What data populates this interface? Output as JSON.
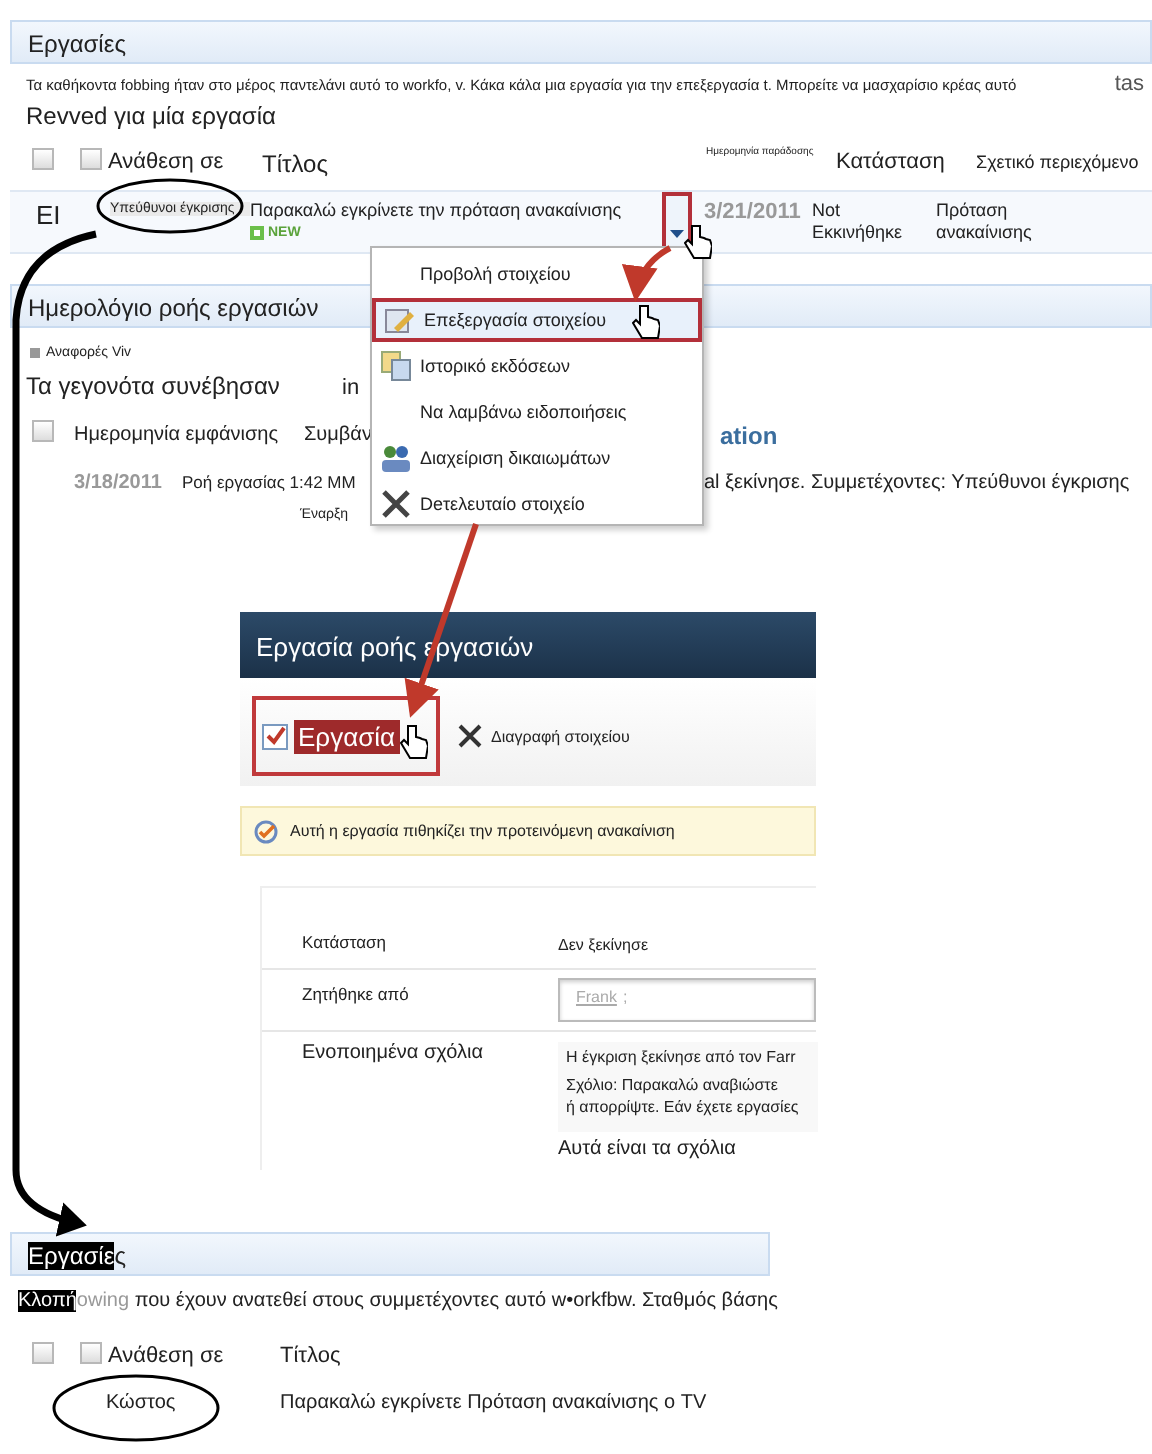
{
  "tasks": {
    "title": "Εργασίες",
    "description": "Τα καθήκοντα fobbing ήταν στο μέρος παντελάνι αυτό το workfo, v. Κάκα κάλα μια εργασία για την επεξεργασία t. Μπορείτε να μασχαρίσιο κρέας αυτό",
    "edge_text": "tas",
    "subtitle": "Revved για μία εργασία",
    "select_all": {
      "checked": false
    },
    "select_assigned": {
      "checked": false
    },
    "columns": [
      "Ανάθεση σε",
      "Τίτλος",
      "Ημερομηνία παράδοσης",
      "Κατάσταση",
      "Σχετικό περιεχόμενο"
    ],
    "rows": [
      {
        "code": "EI",
        "assigned_to": "Υπεύθυνοι έγκρισης",
        "title": "Παρακαλώ εγκρίνετε την πρόταση ανακαίνισης",
        "badge": "NEW",
        "due_date": "3/21/2011",
        "status": "Not Εκκινήθηκε",
        "related": "Πρόταση ανακαίνισης"
      }
    ]
  },
  "workflow_history": {
    "title": "Ημερολόγιο ροής εργασιών",
    "reports": "Αναφορές Viv",
    "subtitle": "Τα γεγονότα συνέβησαν",
    "subtitle_cut": "in",
    "select_all": {
      "checked": false
    },
    "columns": [
      "Ημερομηνία εμφάνισης",
      "Συμβάν",
      "ation"
    ],
    "rows": [
      {
        "date": "3/18/2011",
        "event": "Ροή εργασίας 1:42 MM",
        "description": "al ξεκίνησε. Συμμετέχοντες: Υπεύθυνοι έγκρισης",
        "note": "Έναρξη"
      }
    ]
  },
  "context_menu": {
    "items": [
      {
        "label": "Προβολή στοιχείου",
        "kind": "plain",
        "selected": false
      },
      {
        "label": "Επεξεργασία στοιχείου",
        "kind": "edit",
        "selected": true
      },
      {
        "label": "Ιστορικό εκδόσεων",
        "kind": "versions",
        "selected": false
      },
      {
        "label": "Να λαμβάνω ειδοποιήσεις",
        "kind": "plain",
        "selected": false
      },
      {
        "label": "Διαχείριση δικαιωμάτων",
        "kind": "permissions",
        "selected": false
      },
      {
        "label": "Deτελευταίο στοιχείο",
        "kind": "delete",
        "selected": false
      }
    ]
  },
  "task_form": {
    "title": "Εργασία ροής εργασιών",
    "toolbar": [
      {
        "label": "Εργασία",
        "kind": "task",
        "selected": true
      },
      {
        "label": "Διαγραφή στοιχείου",
        "kind": "delete",
        "selected": false
      }
    ],
    "notice": "Αυτή η εργασία πιθηκίζει την προτεινόμενη ανακαίνιση",
    "fields": [
      {
        "kind": "text",
        "label": "Κατάσταση",
        "value": "Δεν ξεκίνησε"
      },
      {
        "kind": "people",
        "label": "Ζητήθηκε από",
        "value": "Frank",
        "separator": ";"
      },
      {
        "kind": "comments",
        "label": "Ενοποιημένα σχόλια",
        "lines": [
          "Η έγκριση ξεκίνησε από τον Farr",
          "Σχόλιο: Παρακαλώ αναβιώστε\nή απορρίψτε. Εάν έχετε εργασίες"
        ],
        "footer": "Αυτά είναι τα σχόλια"
      }
    ]
  },
  "bottom_tasks": {
    "title_highlighted": "Εργασίε",
    "title_rest": "ς",
    "description_highlighted": "Κλοπή",
    "description_faded": "owing",
    "description_rest": " που έχουν ανατεθεί στους συμμετέχοντες αυτό w•orkfbw. Σταθμός βάσης",
    "select_all": {
      "checked": false
    },
    "select_assigned": {
      "checked": false
    },
    "columns": [
      "Ανάθεση σε",
      "Τίτλος"
    ],
    "rows": [
      {
        "assigned_to": "Κώστος",
        "title": "Παρακαλώ εγκρίνετε Πρόταση ανακαίνισης ο TV"
      }
    ]
  }
}
